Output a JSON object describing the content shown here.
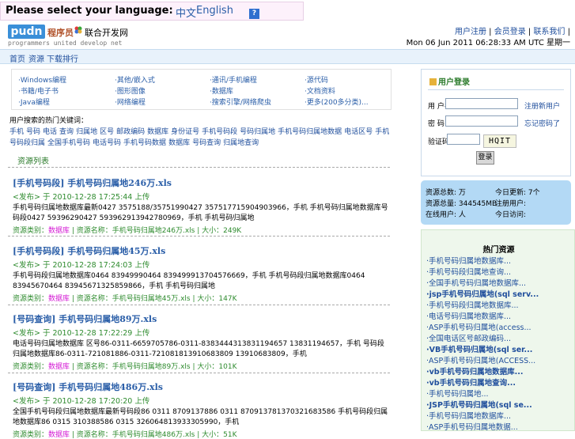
{
  "lang_bar": {
    "prompt": "Please select your language:",
    "option_cn": "中文",
    "option_en": "English",
    "help": "?"
  },
  "logo": {
    "mark": "pudn",
    "cn_name": "程序员",
    "cn_name2": "联合开发网",
    "subtitle": "programmers united develop net"
  },
  "top_links": {
    "l1": "用户注册",
    "l2": "会员登录",
    "l3": "联系我们"
  },
  "datetime": "Mon 06 Jun 2011 06:28:33 AM UTC 星期一",
  "nav": [
    "首页",
    "资源",
    "下载排行"
  ],
  "categories": [
    [
      "·Windows编程",
      "·书籍/电子书",
      "·Java编程"
    ],
    [
      "·其他/嵌入式",
      "·图形图像",
      "·网络编程"
    ],
    [
      "·通讯/手机编程",
      "·数据库",
      "·搜索引擎/网络爬虫"
    ],
    [
      "·源代码",
      "·文档资料",
      "·更多(200多分类)..."
    ]
  ],
  "tag_title": "用户搜索的热门关键词：",
  "tags": [
    "手机",
    "号码",
    "电话",
    "查询",
    "归属地",
    "区号",
    "邮政编码",
    "数据库",
    "身份证号",
    "手机号码段",
    "号码归属地",
    "手机号码归属地数据",
    "电话区号",
    "手机号码段归属",
    "全国手机号码",
    "电话号码",
    "手机号码数据",
    "数据库",
    "号码查询",
    "归属地查询"
  ],
  "section_title": "资源列表",
  "results": [
    {
      "title": "[手机号码段] 手机号码归属地246万.xls",
      "date": "<发布> 于 2010-12-28 17:25:44 上传",
      "body": "手机号码归属地数据库最新0427 3575188/35751990427 357517715904903966，手机 手机号码归属地数据库号码段0427 59396290427 593962913942780969，手机 手机号码归属地",
      "meta_prefix": "资源类别：",
      "meta_hot": "数据库",
      "meta_file": "资源名称：手机号码归属地246万.xls",
      "meta_size": "大小：249K"
    },
    {
      "title": "[手机号码段] 手机号码归属地45万.xls",
      "date": "<发布> 于 2010-12-28 17:24:03 上传",
      "body": "手机号码段归属地数据库0464 83949990464 839499913704576669，手机 手机号码段归属地数据库0464 83945670464 83945671325859866，手机 手机号码归属地",
      "meta_prefix": "资源类别：",
      "meta_hot": "数据库",
      "meta_file": "资源名称：手机号码归属地45万.xls",
      "meta_size": "大小：147K"
    },
    {
      "title": "[号码查询] 手机号码归属地89万.xls",
      "date": "<发布> 于 2010-12-28 17:22:29 上传",
      "body": "电话号码归属地数据库 区号86-0311-6659705786-0311-8383444313831194657 13831194657，手机 号码段归属地数据库86-0311-721081886-0311-721081813910683809 13910683809，手机",
      "meta_prefix": "资源类别：",
      "meta_hot": "数据库",
      "meta_file": "资源名称：手机号码归属地89万.xls",
      "meta_size": "大小：101K"
    },
    {
      "title": "[号码查询] 手机号码归属地486万.xls",
      "date": "<发布> 于 2010-12-28 17:20:20 上传",
      "body": "全国手机号码段归属地数据库最新号码段86 0311 8709137886 0311 870913781370321683586 手机号码段归属地数据库86 0315 310388586 0315 326064813933305990，手机",
      "meta_prefix": "资源类别：",
      "meta_hot": "数据库",
      "meta_file": "资源名称：手机号码归属地486万.xls",
      "meta_size": "大小：51K"
    }
  ],
  "login": {
    "header": "用户登录",
    "user_label": "用 户名",
    "pass_label": "密 码",
    "code_label": "验证码：",
    "register": "注册新用户",
    "forgot": "忘记密码了",
    "captcha": "HQIT",
    "submit": "登录"
  },
  "stats": [
    [
      "资源总数: 万",
      "今日更新: 7个"
    ],
    [
      "资源总量: 344545MB",
      "注册用户:"
    ],
    [
      "在线用户: 人",
      "今日访问:"
    ]
  ],
  "hot": {
    "title": "热门资源",
    "items": [
      {
        "t": "·手机号码归属地数据库...",
        "b": false
      },
      {
        "t": "·手机号码段归属地查询...",
        "b": false
      },
      {
        "t": "·全国手机号码归属地数据库...",
        "b": false
      },
      {
        "t": "·jsp手机号码归属地(sql serv...",
        "b": true
      },
      {
        "t": "·手机号码段归属地数据库...",
        "b": false
      },
      {
        "t": "·电话号码归属地数据库...",
        "b": false
      },
      {
        "t": "·ASP手机号码归属地(access...",
        "b": false
      },
      {
        "t": "·全国电话区号邮政编码...",
        "b": false
      },
      {
        "t": "·VB手机号码归属地(sql ser...",
        "b": true
      },
      {
        "t": "·ASP手机号码归属地(ACCESS...",
        "b": false
      },
      {
        "t": "·vb手机号码归属地数据库...",
        "b": true
      },
      {
        "t": "·vb手机号码归属地查询...",
        "b": true
      },
      {
        "t": "·手机号码归属地...",
        "b": false
      },
      {
        "t": "·JSP手机号码归属地(sql se...",
        "b": true
      },
      {
        "t": "·手机号码归属地数据库...",
        "b": false
      },
      {
        "t": "·ASP手机号码归属地数据...",
        "b": false
      }
    ]
  }
}
